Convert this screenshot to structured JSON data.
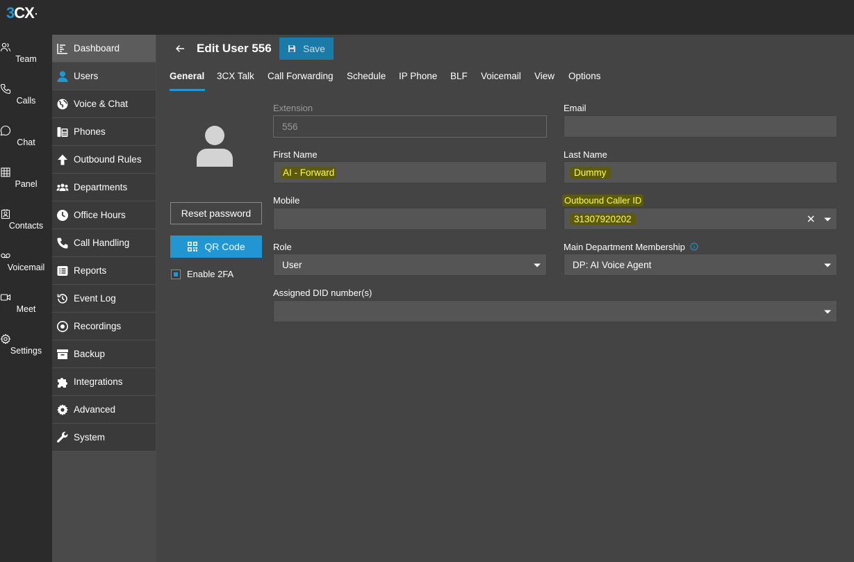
{
  "app": {
    "logo_num": "3",
    "logo_text": "CX"
  },
  "rail": [
    {
      "label": "Team",
      "icon": "team-icon"
    },
    {
      "label": "Calls",
      "icon": "phone-icon"
    },
    {
      "label": "Chat",
      "icon": "chat-icon"
    },
    {
      "label": "Panel",
      "icon": "grid-icon"
    },
    {
      "label": "Contacts",
      "icon": "contacts-icon"
    },
    {
      "label": "Voicemail",
      "icon": "voicemail-icon"
    },
    {
      "label": "Meet",
      "icon": "video-icon"
    },
    {
      "label": "Settings",
      "icon": "gear-icon"
    }
  ],
  "nav": [
    {
      "label": "Dashboard",
      "icon": "dashboard-icon"
    },
    {
      "label": "Users",
      "icon": "user-icon"
    },
    {
      "label": "Voice & Chat",
      "icon": "globe-icon"
    },
    {
      "label": "Phones",
      "icon": "phones-icon"
    },
    {
      "label": "Outbound Rules",
      "icon": "arrow-up-icon"
    },
    {
      "label": "Departments",
      "icon": "group-icon"
    },
    {
      "label": "Office Hours",
      "icon": "clock-icon"
    },
    {
      "label": "Call Handling",
      "icon": "phone-icon"
    },
    {
      "label": "Reports",
      "icon": "reports-icon"
    },
    {
      "label": "Event Log",
      "icon": "history-icon"
    },
    {
      "label": "Recordings",
      "icon": "record-icon"
    },
    {
      "label": "Backup",
      "icon": "archive-icon"
    },
    {
      "label": "Integrations",
      "icon": "puzzle-icon"
    },
    {
      "label": "Advanced",
      "icon": "cog-icon"
    },
    {
      "label": "System",
      "icon": "wrench-icon"
    }
  ],
  "header": {
    "title": "Edit User 556",
    "save_label": "Save"
  },
  "tabs": [
    "General",
    "3CX Talk",
    "Call Forwarding",
    "Schedule",
    "IP Phone",
    "BLF",
    "Voicemail",
    "View",
    "Options"
  ],
  "side": {
    "reset_label": "Reset password",
    "qr_label": "QR Code",
    "twofa_label": "Enable 2FA",
    "twofa_checked": true
  },
  "form": {
    "extension": {
      "label": "Extension",
      "value": "556"
    },
    "email": {
      "label": "Email",
      "value": ""
    },
    "first_name": {
      "label": "First Name",
      "value": "AI - Forward"
    },
    "last_name": {
      "label": "Last Name",
      "value": "Dummy"
    },
    "mobile": {
      "label": "Mobile",
      "value": ""
    },
    "outbound_caller_id": {
      "label": "Outbound Caller ID",
      "value": "31307920202"
    },
    "role": {
      "label": "Role",
      "value": "User"
    },
    "department": {
      "label": "Main Department Membership",
      "value": "DP: AI Voice Agent"
    },
    "did": {
      "label": "Assigned DID number(s)",
      "value": ""
    }
  },
  "colors": {
    "accent": "#1d9ad6",
    "highlight_text": "#ffff3a",
    "highlight_bg": "#5b5a10"
  }
}
